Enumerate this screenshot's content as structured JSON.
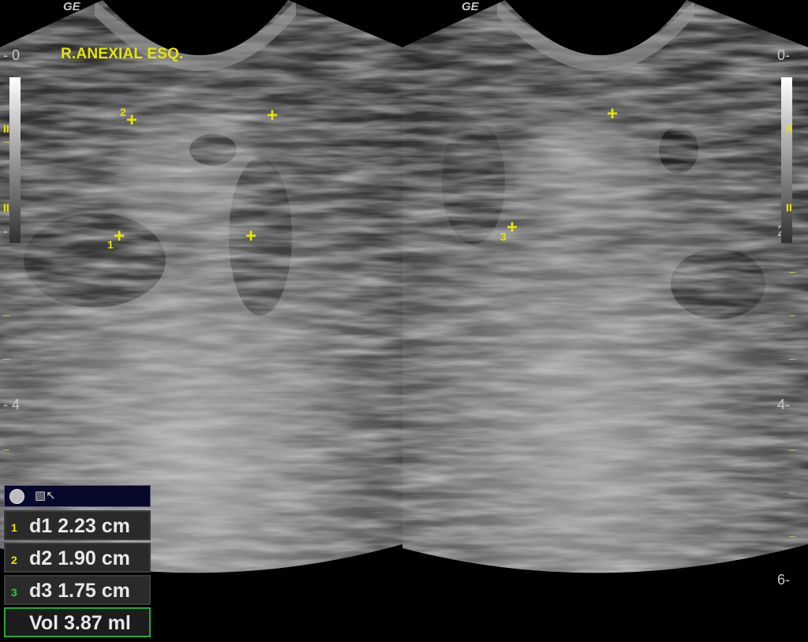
{
  "header": {
    "brand_left": "GE",
    "brand_right": "GE",
    "title": "R.ANEXIAL ESQ."
  },
  "depth_scale": {
    "left": [
      "0",
      "2",
      "4"
    ],
    "right": [
      "0",
      "2",
      "4",
      "6"
    ]
  },
  "focus_marker": "II",
  "calipers": [
    {
      "label": "1",
      "panel": "left"
    },
    {
      "label": "2",
      "panel": "left"
    },
    {
      "label": "3",
      "panel": "right"
    }
  ],
  "measurements": {
    "rows": [
      {
        "index": "1",
        "text": "d1  2.23 cm",
        "index_color": "#e6e600"
      },
      {
        "index": "2",
        "text": "d2  1.90 cm",
        "index_color": "#e6e600"
      },
      {
        "index": "3",
        "text": "d3  1.75 cm",
        "index_color": "#20d040"
      },
      {
        "index": "",
        "text": "Vol  3.87 ml",
        "index_color": "#e6e600"
      }
    ],
    "header_icons": [
      "circle-icon",
      "cursor-icon"
    ]
  },
  "colors": {
    "annotation": "#e6e600",
    "active_border": "#1faa3a"
  }
}
